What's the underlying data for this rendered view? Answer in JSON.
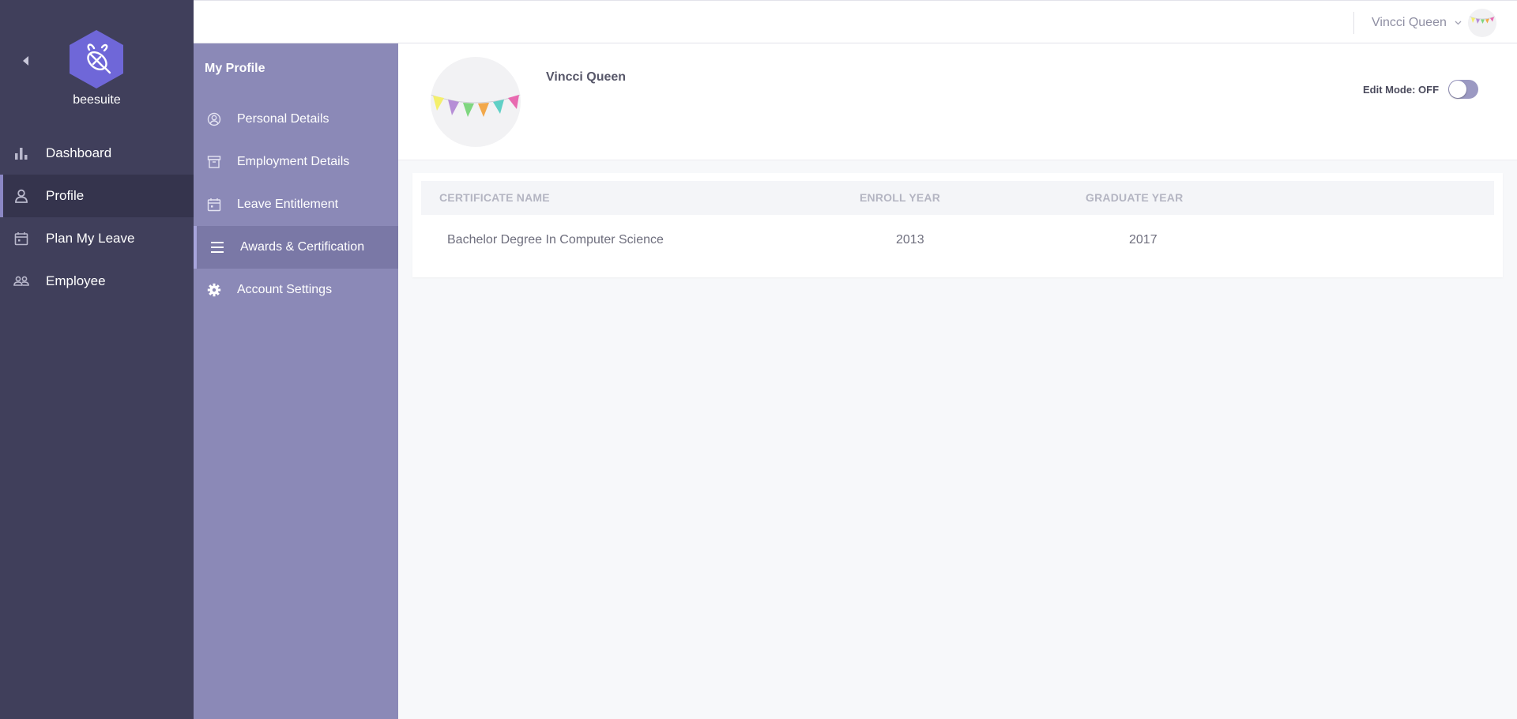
{
  "brand": {
    "name": "beesuite",
    "color": "#6f67d8"
  },
  "sidebar": {
    "items": [
      {
        "label": "Dashboard",
        "icon": "bar-chart-icon"
      },
      {
        "label": "Profile",
        "icon": "person-icon",
        "active": true
      },
      {
        "label": "Plan My Leave",
        "icon": "calendar-icon"
      },
      {
        "label": "Employee",
        "icon": "people-icon"
      }
    ]
  },
  "subsidebar": {
    "title": "My Profile",
    "items": [
      {
        "label": "Personal Details",
        "icon": "user-circle-icon"
      },
      {
        "label": "Employment Details",
        "icon": "archive-icon"
      },
      {
        "label": "Leave Entitlement",
        "icon": "calendar-icon"
      },
      {
        "label": "Awards & Certification",
        "icon": "list-icon",
        "active": true
      },
      {
        "label": "Account Settings",
        "icon": "gear-icon"
      }
    ]
  },
  "header": {
    "user_name": "Vincci Queen"
  },
  "profile": {
    "name": "Vincci Queen",
    "edit_mode_label": "Edit Mode: OFF",
    "edit_mode": false
  },
  "certificates": {
    "columns": [
      "CERTIFICATE NAME",
      "ENROLL YEAR",
      "GRADUATE YEAR"
    ],
    "rows": [
      {
        "name": "Bachelor Degree In Computer Science",
        "enroll_year": "2013",
        "graduate_year": "2017"
      }
    ]
  },
  "colors": {
    "sidebar_bg": "#403f5b",
    "subsidebar_bg": "#8b89b7",
    "accent": "#8b87c4"
  }
}
